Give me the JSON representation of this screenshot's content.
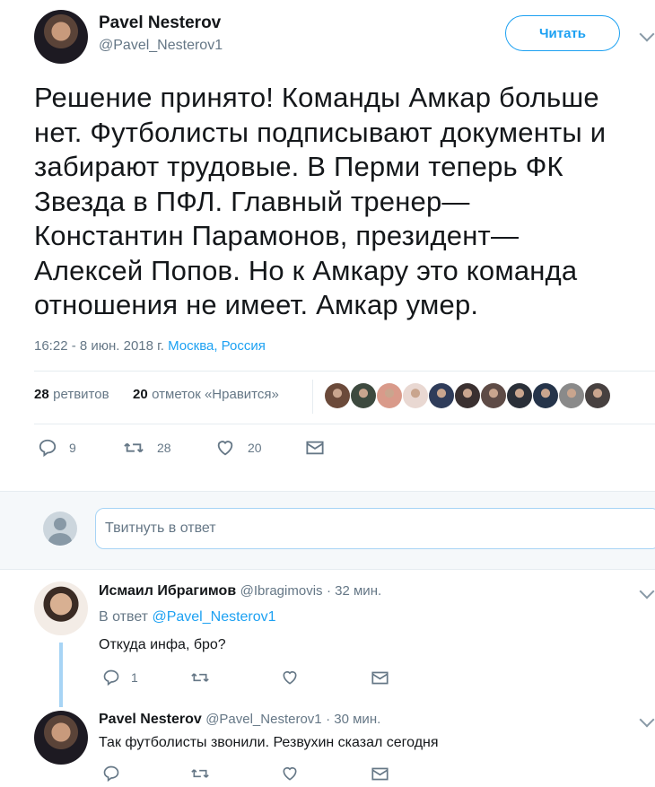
{
  "tweet": {
    "author_name": "Pavel Nesterov",
    "author_handle": "@Pavel_Nesterov1",
    "follow_label": "Читать",
    "text": "Решение принято! Команды Амкар больше\nнет. Футболисты подписывают документы и\nзабирают трудовые. В Перми теперь ФК\nЗвезда в ПФЛ. Главный тренер—\nКонстантин Парамонов, президент—\nАлексей Попов. Но к Амкару это команда\nотношения не имеет. Амкар умер.",
    "timestamp": "16:22 - 8 июн. 2018 г.",
    "location": "Москва, Россия",
    "retweets_count": "28",
    "retweets_label": "ретвитов",
    "likes_count": "20",
    "likes_label": "отметок «Нравится»",
    "actions": {
      "replies": "9",
      "retweets": "28",
      "likes": "20"
    }
  },
  "liker_avatar_colors": [
    "#6b4a3a",
    "#3d4a3f",
    "#d99a8a",
    "#e9d8d2",
    "#2f3c5a",
    "#3a3030",
    "#5e4b46",
    "#2a2f38",
    "#25344a",
    "#8a8a8a",
    "#474140"
  ],
  "compose": {
    "placeholder": "Твитнуть в ответ"
  },
  "replies": [
    {
      "name": "Исмаил Ибрагимов",
      "handle": "@Ibragimovis",
      "time": "· 32 мин.",
      "reply_to_prefix": "В ответ",
      "reply_to_handle": "@Pavel_Nesterov1",
      "text": "Откуда инфа, бро?",
      "actions": {
        "replies": "1",
        "retweets": "",
        "likes": ""
      }
    },
    {
      "name": "Pavel Nesterov",
      "handle": "@Pavel_Nesterov1",
      "time": "· 30 мин.",
      "text": "Так футболисты звонили. Резвухин сказал сегодня",
      "actions": {
        "replies": "",
        "retweets": "",
        "likes": ""
      }
    }
  ],
  "colors": {
    "accent": "#1da1f2",
    "muted": "#657786",
    "thread": "#a7d4f5"
  }
}
